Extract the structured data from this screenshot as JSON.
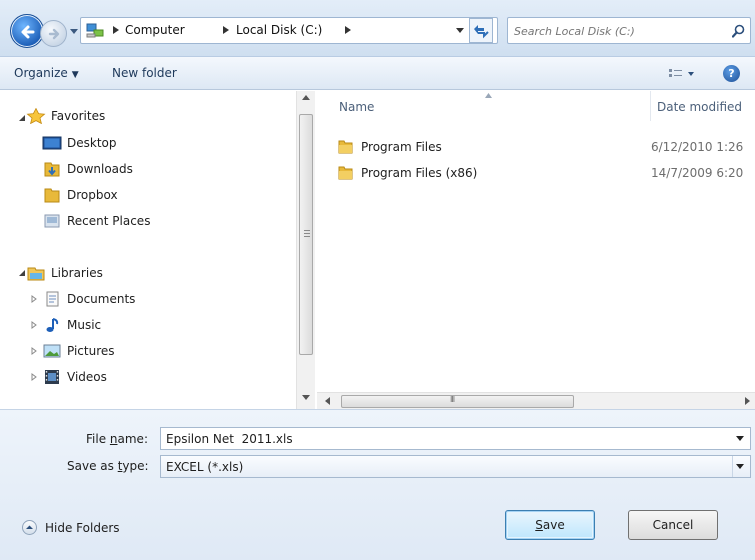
{
  "address_bar": {
    "breadcrumbs": [
      "Computer",
      "Local Disk (C:)"
    ],
    "search_placeholder": "Search Local Disk (C:)"
  },
  "toolbar": {
    "organize_label": "Organize",
    "new_folder_label": "New folder",
    "help_label": "?"
  },
  "navigation": {
    "favorites_label": "Favorites",
    "favorites": [
      "Desktop",
      "Downloads",
      "Dropbox",
      "Recent Places"
    ],
    "libraries_label": "Libraries",
    "libraries": [
      "Documents",
      "Music",
      "Pictures",
      "Videos"
    ]
  },
  "file_list": {
    "columns": {
      "name": "Name",
      "date_modified": "Date modified"
    },
    "rows": [
      {
        "name": "Program Files",
        "date": "6/12/2010 1:26"
      },
      {
        "name": "Program Files (x86)",
        "date": "14/7/2009 6:20"
      }
    ],
    "hscroll_grip": "III"
  },
  "save_form": {
    "file_name_label_pre": "File ",
    "file_name_label_key": "n",
    "file_name_label_post": "ame:",
    "file_name_value": "Epsilon Net  2011.xls",
    "save_type_label_pre": "Save as ",
    "save_type_label_key": "t",
    "save_type_label_post": "ype:",
    "save_type_value": "EXCEL (*.xls)"
  },
  "footer": {
    "hide_folders_label": "Hide Folders",
    "save_key": "S",
    "save_rest": "ave",
    "cancel_label": "Cancel"
  },
  "colors": {
    "accent": "#1d5fb8",
    "folder": "#e8b93a",
    "chrome_bg": "#dfe9f5"
  }
}
